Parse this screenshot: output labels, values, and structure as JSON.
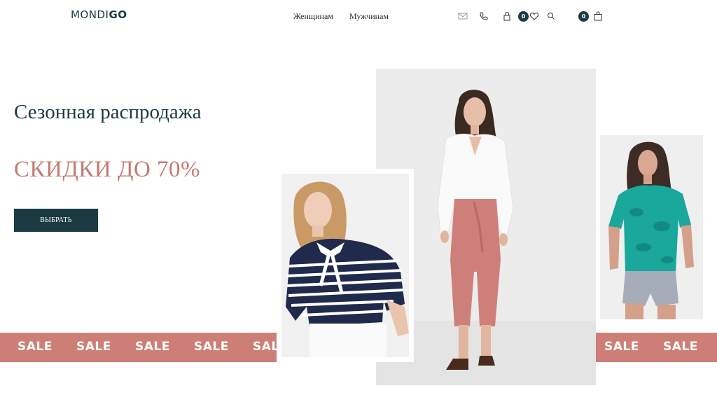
{
  "brand": {
    "logo_light": "MONDI",
    "logo_bold": "GO"
  },
  "nav": {
    "women": "Женщинам",
    "men": "Мужчинам"
  },
  "header_icons": {
    "mail": "mail-icon",
    "phone": "phone-icon",
    "account": "lock-icon",
    "favorites": "heart-icon",
    "search": "search-icon",
    "cart": "shopping-bag-icon",
    "favorites_count": "0",
    "cart_count": "0"
  },
  "hero": {
    "title": "Сезонная распродажа",
    "subtitle": "СКИДКИ ДО 70%",
    "cta_label": "ВЫБРАТЬ"
  },
  "sale_band": {
    "words": [
      "SALE",
      "SALE",
      "SALE",
      "SALE",
      "SALE",
      "SALE",
      "SALE",
      "SALE",
      "SALE",
      "SALE"
    ],
    "color": "#cd7f77"
  },
  "colors": {
    "primary": "#1c3a42",
    "accent": "#c47b73"
  }
}
